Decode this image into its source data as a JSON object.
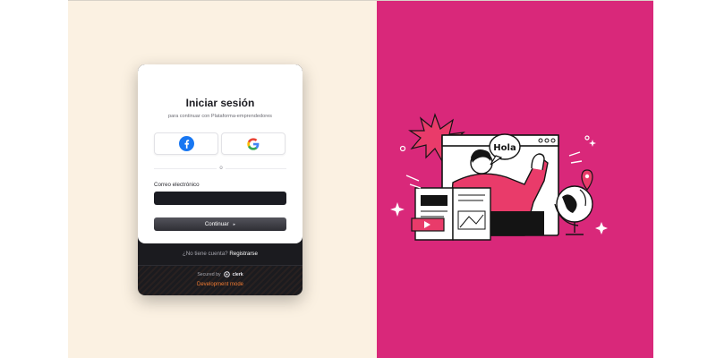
{
  "signin": {
    "title": "Iniciar sesión",
    "subtitle": "para continuar con Plataforma-emprendedores",
    "divider_text": "o",
    "email_label": "Correo electrónico",
    "email_value": "",
    "continue_label": "Continuar",
    "continue_icon": "triangle-right-icon",
    "social_providers": [
      {
        "name": "Facebook",
        "icon": "facebook-icon",
        "color": "#1877F2"
      },
      {
        "name": "Google",
        "icon": "google-icon"
      }
    ]
  },
  "footer": {
    "signup_prompt": "¿No tiene cuenta?",
    "signup_link": "Registrarse",
    "secured_by": "Secured by",
    "brand": "clerk",
    "dev_mode": "Development mode"
  },
  "illustration": {
    "speech_text": "Hola",
    "icons": [
      "person-waving",
      "browser-window",
      "open-book",
      "globe-icon",
      "location-pin-icon",
      "video-player-icon",
      "sparkle-icon"
    ]
  },
  "colors": {
    "left_bg": "#fbf1e2",
    "right_bg": "#d9287a",
    "card_dark": "#1b1b1f",
    "dev_mode": "#f07a32"
  }
}
